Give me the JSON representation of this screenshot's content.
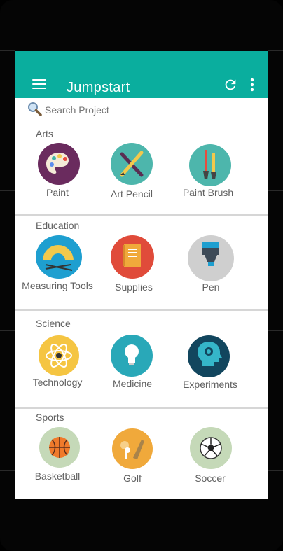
{
  "app": {
    "title": "Jumpstart",
    "accent_color": "#0aae9e"
  },
  "toolbar": {
    "menu_icon": "hamburger-menu-icon",
    "refresh_icon": "refresh-icon",
    "more_icon": "more-vertical-icon"
  },
  "search": {
    "placeholder": "Search Project",
    "icon": "magnifier-icon"
  },
  "sections": [
    {
      "title": "Arts",
      "items": [
        {
          "label": "Paint",
          "icon": "palette-icon",
          "color": "#6a2b5e"
        },
        {
          "label": "Art Pencil",
          "icon": "crossed-pencils-icon",
          "color": "#4db6ac"
        },
        {
          "label": "Paint Brush",
          "icon": "paint-brushes-icon",
          "color": "#4db6ac"
        }
      ]
    },
    {
      "title": "Education",
      "items": [
        {
          "label": "Measuring Tools",
          "icon": "protractor-icon",
          "color": "#1e9fd0"
        },
        {
          "label": "Supplies",
          "icon": "notebook-icon",
          "color": "#e04b3a"
        },
        {
          "label": "Pen",
          "icon": "marker-icon",
          "color": "#cfcfcf"
        }
      ]
    },
    {
      "title": "Science",
      "items": [
        {
          "label": "Technology",
          "icon": "atom-icon",
          "color": "#f5c542"
        },
        {
          "label": "Medicine",
          "icon": "lightbulb-icon",
          "color": "#29a8b8"
        },
        {
          "label": "Experiments",
          "icon": "head-gear-icon",
          "color": "#12465e"
        }
      ]
    },
    {
      "title": "Sports",
      "items": [
        {
          "label": "Basketball",
          "icon": "basketball-icon",
          "color": "#c5d9b8"
        },
        {
          "label": "Golf",
          "icon": "golf-icon",
          "color": "#f0a93b"
        },
        {
          "label": "Soccer",
          "icon": "soccer-ball-icon",
          "color": "#c5d9b8"
        }
      ]
    }
  ]
}
